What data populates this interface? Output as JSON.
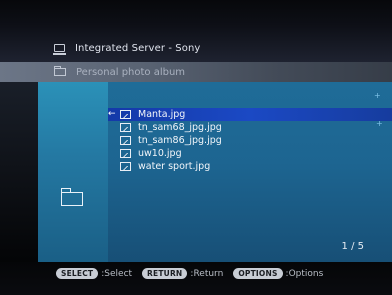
{
  "header": {
    "server_name": "Integrated Server - Sony",
    "folder_name": "Personal photo album"
  },
  "file_list": {
    "items": [
      {
        "label": "Manta.jpg",
        "selected": true
      },
      {
        "label": "tn_sam68_jpg.jpg",
        "selected": false
      },
      {
        "label": "tn_sam86_jpg.jpg",
        "selected": false
      },
      {
        "label": "uw10.jpg",
        "selected": false
      },
      {
        "label": "water sport.jpg",
        "selected": false
      }
    ],
    "page_indicator": "1 / 5"
  },
  "help_bar": {
    "select_key": "SELECT",
    "select_label": ":Select",
    "return_key": "RETURN",
    "return_label": ":Return",
    "options_key": "OPTIONS",
    "options_label": ":Options"
  },
  "colors": {
    "list_background": "#1d6591",
    "selected_row": "#1b49c4",
    "thumb_panel": "#2479a3"
  },
  "icons": {
    "server": "computer-icon",
    "folder": "folder-icon",
    "file": "image-file-icon",
    "cursor": "left-arrow-icon"
  }
}
